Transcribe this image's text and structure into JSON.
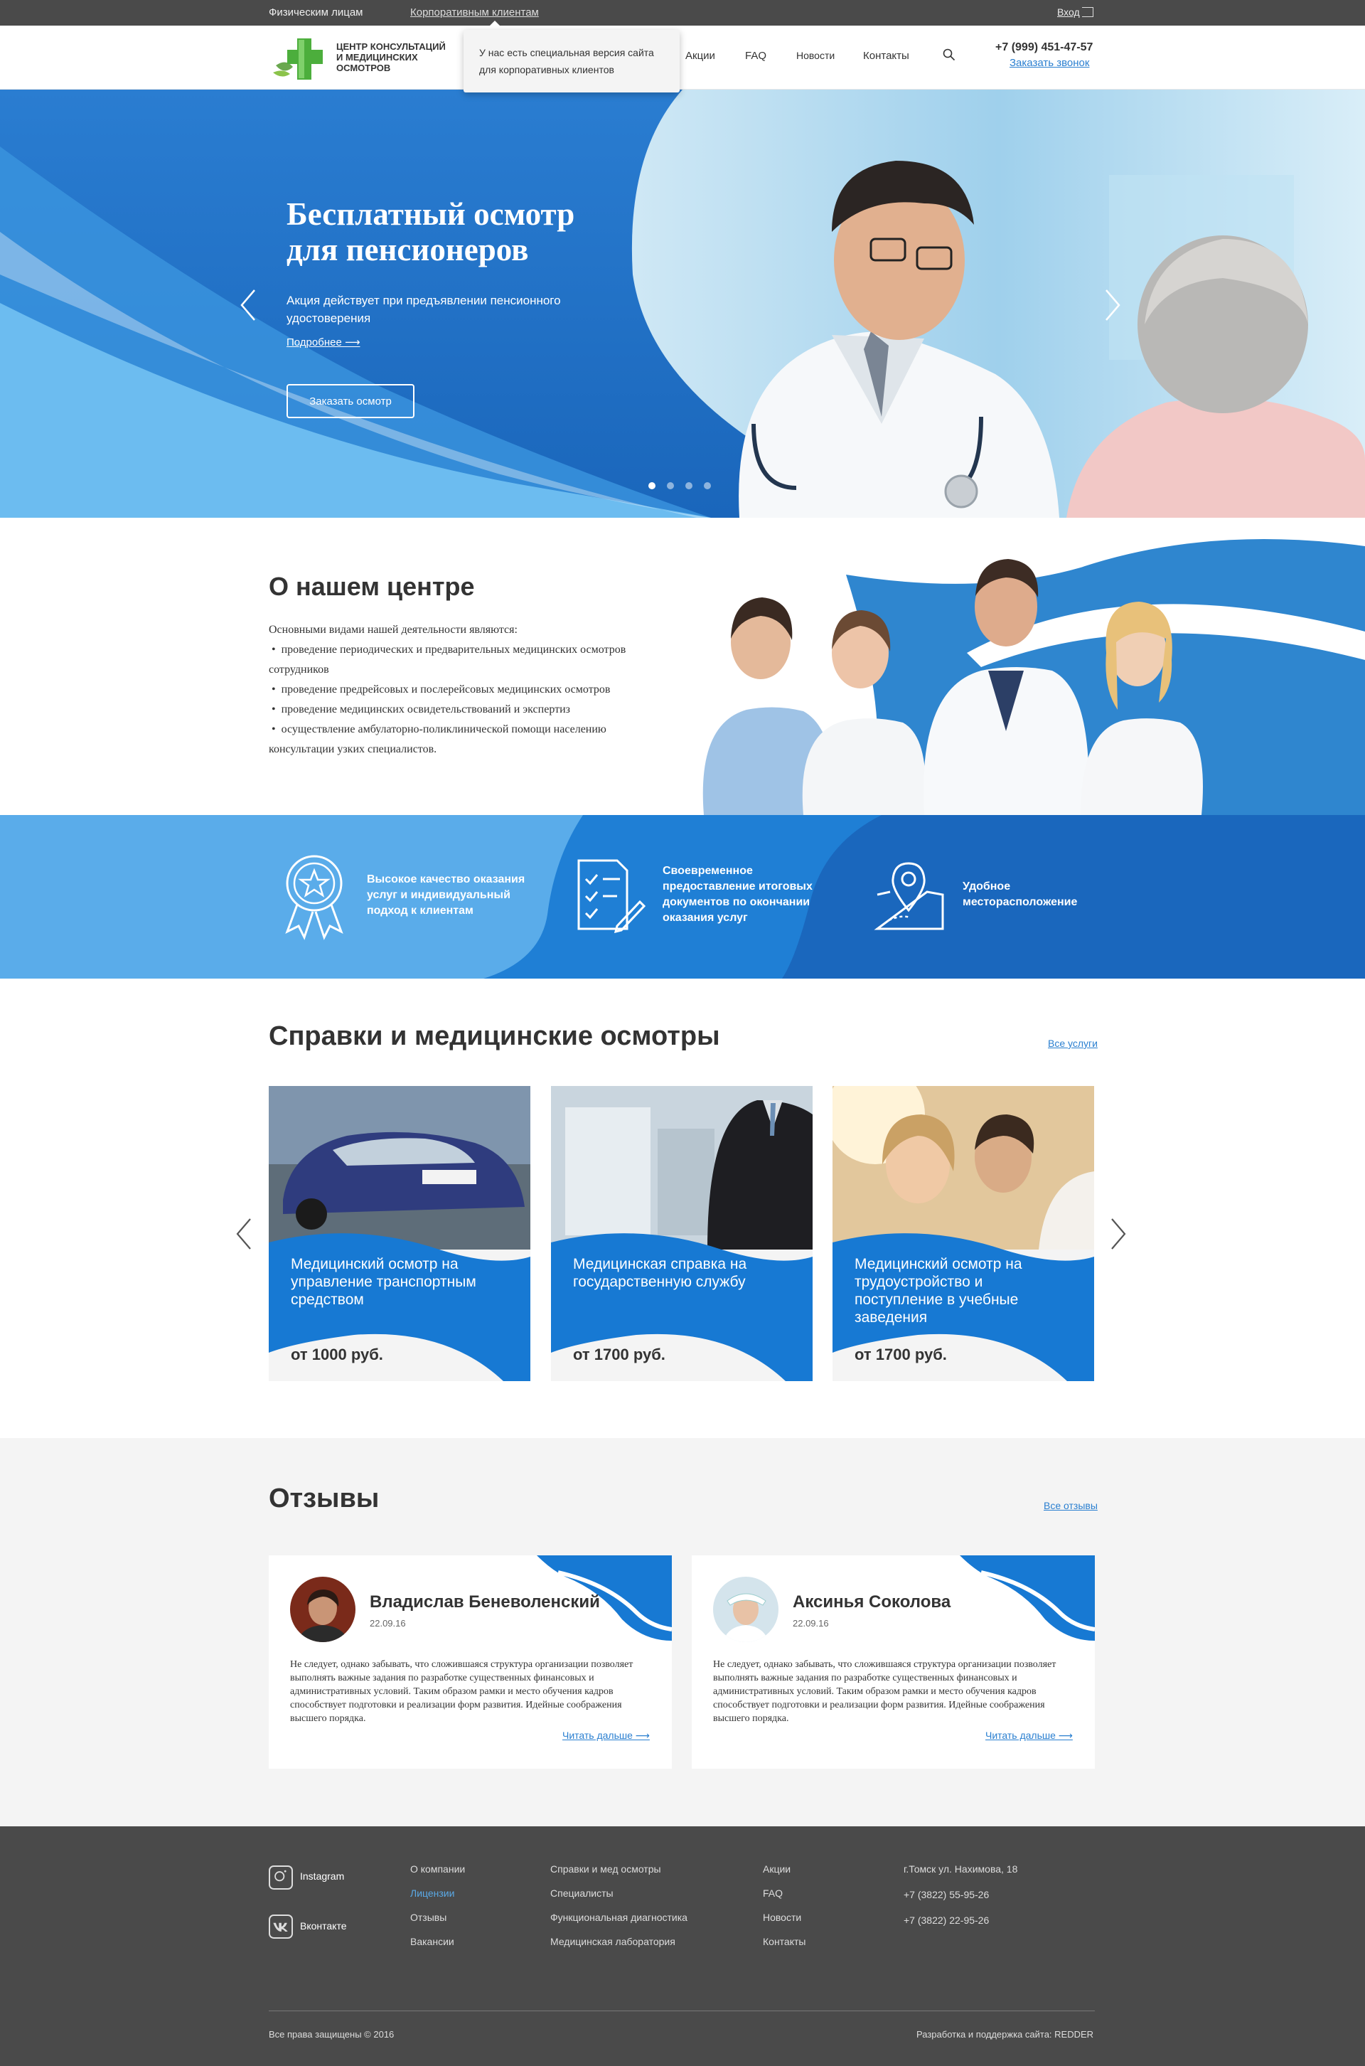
{
  "topbar": {
    "individuals": "Физическим лицам",
    "corporate": "Корпоративным клиентам",
    "login": "Вход"
  },
  "header": {
    "logo_line1": "ЦЕНТР КОНСУЛЬТАЦИЙ",
    "logo_line2": "И МЕДИЦИНСКИХ",
    "logo_line3": "ОСМОТРОВ",
    "nav": [
      "Акции",
      "FAQ",
      "Новости",
      "Контакты"
    ],
    "phone": "+7 (999) 451-47-57",
    "callback": "Заказать звонок",
    "tooltip": "У нас есть специальная версия сайта для корпоративных клиентов"
  },
  "hero": {
    "title_line1": "Бесплатный осмотр",
    "title_line2": "для пенсионеров",
    "subtitle": "Акция действует при предъявлении пенсионного удостоверения",
    "more": "Подробнее ⟶",
    "button": "Заказать осмотр",
    "slides": 4,
    "active_slide": 1
  },
  "about": {
    "title": "О нашем центре",
    "intro": "Основными видами нашей деятельности являются:",
    "items": [
      "проведение периодических и предварительных медицинских осмотров сотрудников",
      "проведение предрейсовых и послерейсовых медицинских осмотров",
      "проведение медицинских освидетельствований и экспертиз",
      "осуществление амбулаторно-поликлинической помощи населению консультации узких специалистов."
    ]
  },
  "features": [
    {
      "icon": "award-icon",
      "text": "Высокое качество оказания услуг и индивидуальный подход к клиентам"
    },
    {
      "icon": "document-checklist-icon",
      "text": "Своевременное предоставление итоговых документов по окончании оказания услуг"
    },
    {
      "icon": "map-pin-icon",
      "text": "Удобное месторасположение"
    }
  ],
  "services": {
    "title": "Справки и медицинские осмотры",
    "all_link": "Все услуги",
    "cards": [
      {
        "title": "Медицинский осмотр на управление транспортным средством",
        "price": "от 1000 руб."
      },
      {
        "title": "Медицинская справка на государственную службу",
        "price": "от 1700 руб."
      },
      {
        "title": "Медицинский осмотр на трудоустройство и поступление в учебные заведения",
        "price": "от 1700 руб."
      }
    ]
  },
  "reviews": {
    "title": "Отзывы",
    "all_link": "Все отзывы",
    "items": [
      {
        "name": "Владислав Беневоленский",
        "date": "22.09.16",
        "text": "Не следует, однако забывать, что сложившаяся структура организации позволяет выполнять важные задания по разработке существенных финансовых и административных условий. Таким образом рамки и место обучения кадров способствует подготовки и реализации форм развития. Идейные соображения высшего порядка.",
        "more": "Читать дальше ⟶"
      },
      {
        "name": "Аксинья Соколова",
        "date": "22.09.16",
        "text": "Не следует, однако забывать, что сложившаяся структура организации позволяет выполнять важные задания по разработке существенных финансовых и административных условий. Таким образом рамки и место обучения кадров способствует подготовки и реализации форм развития. Идейные соображения высшего порядка.",
        "more": "Читать дальше ⟶"
      }
    ]
  },
  "footer": {
    "social": [
      "Instagram",
      "Вконтакте"
    ],
    "col1": [
      "О компании",
      "Лицензии",
      "Отзывы",
      "Вакансии"
    ],
    "col2": [
      "Справки и мед осмотры",
      "Специалисты",
      "Функциональная диагностика",
      "Медицинская лаборатория"
    ],
    "col3": [
      "Акции",
      "FAQ",
      "Новости",
      "Контакты"
    ],
    "contacts": [
      "г.Томск ул. Нахимова, 18",
      "+7 (3822) 55-95-26",
      "+7 (3822) 22-95-26"
    ],
    "copyright": "Все права защищены © 2016",
    "dev": "Разработка и поддержка сайта: REDDER",
    "active_link_color": "#5aa9e6"
  },
  "colors": {
    "brand_blue": "#1e73c8",
    "light_blue": "#5aacea",
    "dark_gray": "#4a4a4a",
    "green": "#4cae3c"
  }
}
